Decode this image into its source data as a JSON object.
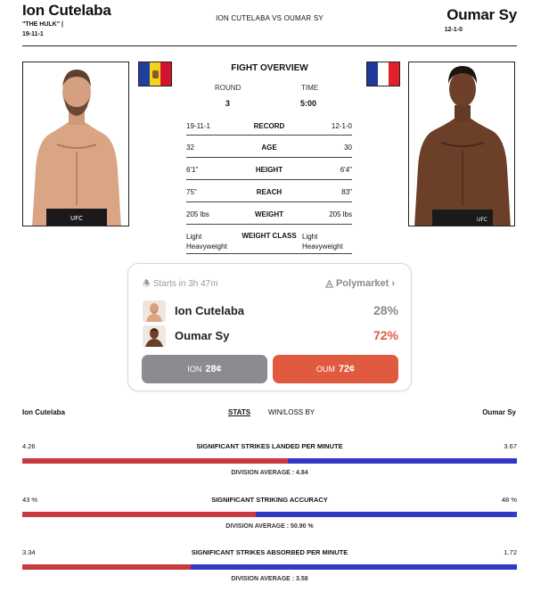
{
  "header": {
    "fighter1_name": "Ion Cutelaba",
    "fighter1_nickname": "\"THE HULK\"  |",
    "fighter1_record": "19-11-1",
    "matchup": "ION CUTELABA VS OUMAR SY",
    "fighter2_name": "Oumar Sy",
    "fighter2_record": "12-1-0"
  },
  "flags": {
    "left": "moldova-flag",
    "right": "france-flag"
  },
  "overview": {
    "title": "FIGHT OVERVIEW",
    "round_label": "ROUND",
    "round_value": "3",
    "time_label": "TIME",
    "time_value": "5:00",
    "rows": [
      {
        "left": "19-11-1",
        "label": "RECORD",
        "right": "12-1-0"
      },
      {
        "left": "32",
        "label": "AGE",
        "right": "30"
      },
      {
        "left": "6'1\"",
        "label": "HEIGHT",
        "right": "6'4\""
      },
      {
        "left": "75\"",
        "label": "REACH",
        "right": "83\""
      },
      {
        "left": "205 lbs",
        "label": "WEIGHT",
        "right": "205 lbs"
      },
      {
        "left": "Light Heavyweight",
        "label": "WEIGHT CLASS",
        "right": "Light Heavyweight"
      }
    ]
  },
  "prediction": {
    "starts_in": "Starts in 3h 47m",
    "source": "Polymarket",
    "candidates": [
      {
        "name": "Ion Cutelaba",
        "percent": "28%",
        "color": "#8a8a8f"
      },
      {
        "name": "Oumar Sy",
        "percent": "72%",
        "color": "#e05a40"
      }
    ],
    "buttons": [
      {
        "label": "ION",
        "price": "28¢"
      },
      {
        "label": "OUM",
        "price": "72¢"
      }
    ]
  },
  "stats_header": {
    "fighter1": "Ion Cutelaba",
    "tab_stats": "STATS",
    "tab_winloss": "WIN/LOSS BY",
    "fighter2": "Oumar Sy"
  },
  "stats": [
    {
      "title": "SIGNIFICANT STRIKES LANDED PER MINUTE",
      "left": "4.26",
      "right": "3.67",
      "left_share": 0.537,
      "average": "DIVISION AVERAGE : 4.84"
    },
    {
      "title": "SIGNIFICANT STRIKING ACCURACY",
      "left": "43 %",
      "right": "48 %",
      "left_share": 0.472,
      "average": "DIVISION AVERAGE : 50.90 %"
    },
    {
      "title": "SIGNIFICANT STRIKES ABSORBED PER MINUTE",
      "left": "3.34",
      "right": "1.72",
      "left_share": 0.34,
      "average": "DIVISION AVERAGE : 3.58"
    }
  ],
  "colors": {
    "red": "#c93a3f",
    "blue": "#3239c2",
    "accent": "#e05a40"
  }
}
